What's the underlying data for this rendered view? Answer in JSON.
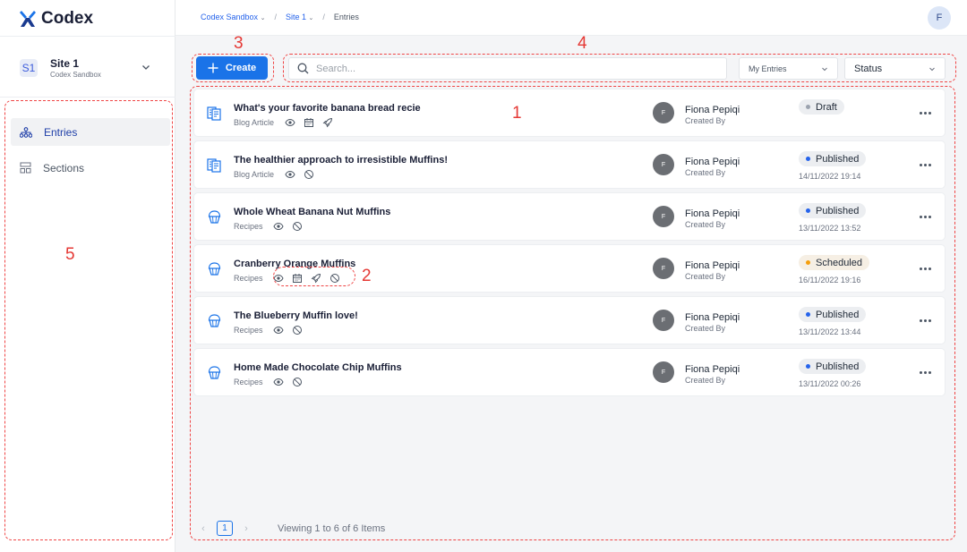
{
  "app": {
    "name": "Codex"
  },
  "site": {
    "badge": "S1",
    "name": "Site 1",
    "org": "Codex Sandbox"
  },
  "sidebar": {
    "items": [
      {
        "label": "Entries",
        "icon": "hierarchy-icon",
        "active": true
      },
      {
        "label": "Sections",
        "icon": "layout-icon",
        "active": false
      }
    ]
  },
  "breadcrumb": {
    "org": "Codex Sandbox",
    "site": "Site 1",
    "current": "Entries"
  },
  "user": {
    "initial": "F"
  },
  "toolbar": {
    "create_label": "Create",
    "search_placeholder": "Search...",
    "filter_mine": "My Entries",
    "filter_status": "Status"
  },
  "entries": [
    {
      "title": "What's your favorite banana bread recie",
      "type": "Blog Article",
      "icon": "article-icon",
      "meta_icons": [
        "eye-icon",
        "calendar-icon",
        "rocket-icon"
      ],
      "author_initial": "F",
      "author": "Fiona Pepiqi",
      "author_sub": "Created By",
      "status": "Draft",
      "status_color": "#9ca3af",
      "date": ""
    },
    {
      "title": "The healthier approach to irresistible Muffins!",
      "type": "Blog Article",
      "icon": "article-icon",
      "meta_icons": [
        "eye-icon",
        "ban-icon"
      ],
      "author_initial": "F",
      "author": "Fiona Pepiqi",
      "author_sub": "Created By",
      "status": "Published",
      "status_color": "#2563eb",
      "date": "14/11/2022 19:14"
    },
    {
      "title": "Whole Wheat Banana Nut Muffins",
      "type": "Recipes",
      "icon": "cupcake-icon",
      "meta_icons": [
        "eye-icon",
        "ban-icon"
      ],
      "author_initial": "F",
      "author": "Fiona Pepiqi",
      "author_sub": "Created By",
      "status": "Published",
      "status_color": "#2563eb",
      "date": "13/11/2022 13:52"
    },
    {
      "title": "Cranberry Orange Muffins",
      "type": "Recipes",
      "icon": "cupcake-icon",
      "meta_icons": [
        "eye-icon",
        "calendar-icon",
        "rocket-icon",
        "ban-icon"
      ],
      "author_initial": "F",
      "author": "Fiona Pepiqi",
      "author_sub": "Created By",
      "status": "Scheduled",
      "status_color": "#f59e0b",
      "date": "16/11/2022 19:16"
    },
    {
      "title": "The Blueberry Muffin love!",
      "type": "Recipes",
      "icon": "cupcake-icon",
      "meta_icons": [
        "eye-icon",
        "ban-icon"
      ],
      "author_initial": "F",
      "author": "Fiona Pepiqi",
      "author_sub": "Created By",
      "status": "Published",
      "status_color": "#2563eb",
      "date": "13/11/2022 13:44"
    },
    {
      "title": "Home Made Chocolate Chip Muffins",
      "type": "Recipes",
      "icon": "cupcake-icon",
      "meta_icons": [
        "eye-icon",
        "ban-icon"
      ],
      "author_initial": "F",
      "author": "Fiona Pepiqi",
      "author_sub": "Created By",
      "status": "Published",
      "status_color": "#2563eb",
      "date": "13/11/2022 00:26"
    }
  ],
  "pagination": {
    "current_page": "1",
    "summary": "Viewing 1 to 6 of 6 Items"
  },
  "annotations": [
    "1",
    "2",
    "3",
    "4",
    "5"
  ],
  "colors": {
    "accent": "#1a73e8",
    "annotation": "#e53935",
    "link": "#2563eb"
  }
}
